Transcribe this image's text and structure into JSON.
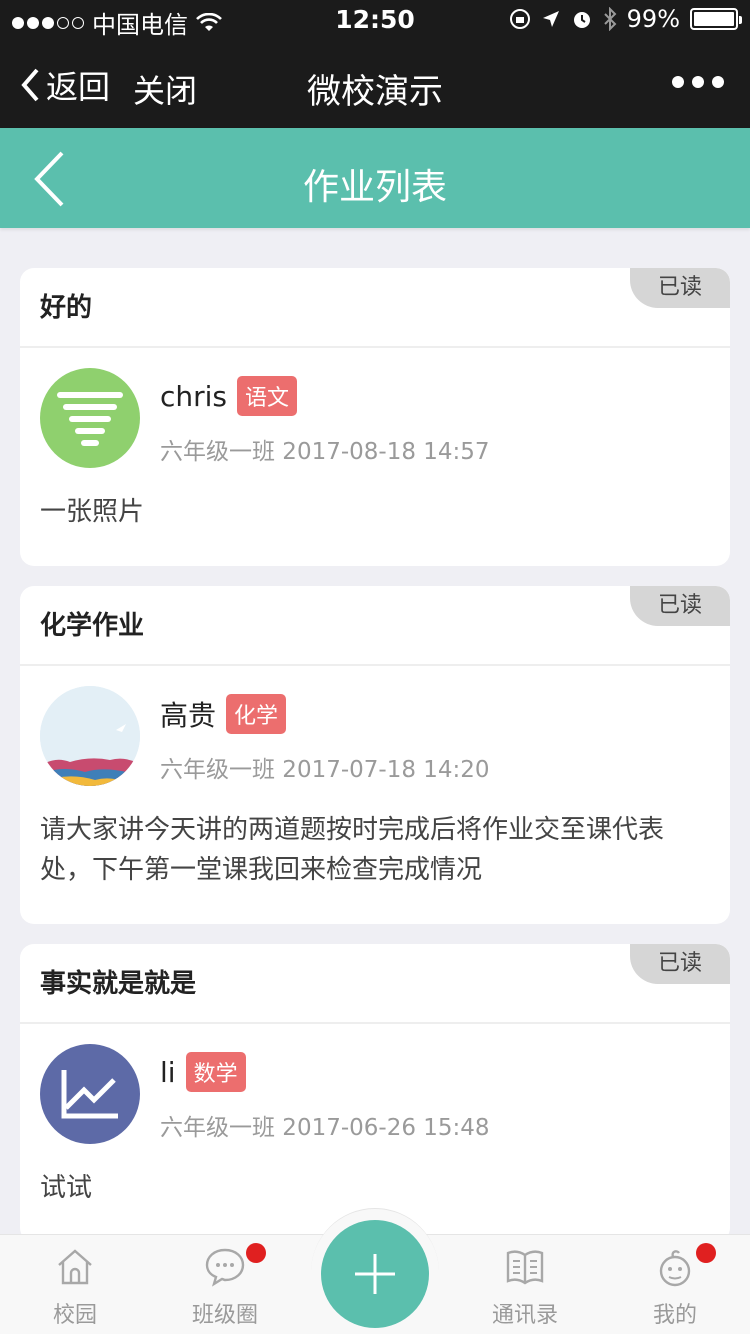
{
  "status_bar": {
    "carrier": "中国电信",
    "time": "12:50",
    "battery": "99%",
    "battery_level": 0.99
  },
  "wechat_nav": {
    "back_label": "返回",
    "close_label": "关闭",
    "title": "微校演示"
  },
  "header": {
    "title": "作业列表"
  },
  "homework": [
    {
      "title": "好的",
      "read_status": "已读",
      "author": "chris",
      "subject": "语文",
      "class_time": "六年级一班 2017-08-18 14:57",
      "content": "一张照片",
      "avatar_icon": "funnel-icon",
      "avatar_color": "#8fd06e"
    },
    {
      "title": "化学作业",
      "read_status": "已读",
      "author": "高贵",
      "subject": "化学",
      "class_time": "六年级一班 2017-07-18 14:20",
      "content": "请大家讲今天讲的两道题按时完成后将作业交至课代表处，下午第一堂课我回来检查完成情况",
      "avatar_icon": "landscape-photo",
      "avatar_color": "#e3eff6"
    },
    {
      "title": "事实就是就是",
      "read_status": "已读",
      "author": "li",
      "subject": "数学",
      "class_time": "六年级一班 2017-06-26 15:48",
      "content": "试试",
      "avatar_icon": "line-chart-icon",
      "avatar_color": "#5d6aa7"
    }
  ],
  "tabbar": {
    "items": [
      {
        "label": "校园",
        "icon": "home-icon"
      },
      {
        "label": "班级圈",
        "icon": "chat-bubble-icon"
      },
      {
        "label": "",
        "icon": "plus-icon"
      },
      {
        "label": "通讯录",
        "icon": "book-icon"
      },
      {
        "label": "我的",
        "icon": "user-icon"
      }
    ]
  },
  "colors": {
    "accent": "#5bbfad",
    "tag": "#ec6e6e",
    "badge": "#e02020"
  }
}
